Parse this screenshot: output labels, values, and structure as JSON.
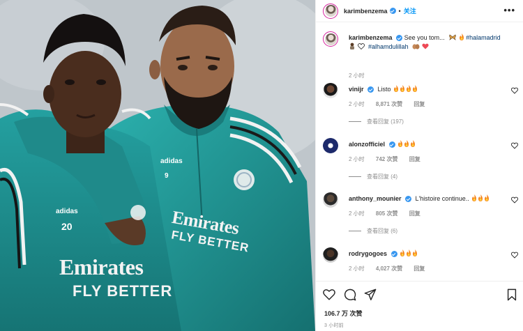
{
  "post": {
    "author": "karimbenzema",
    "follow_label": "关注",
    "more_label": "•••",
    "caption": {
      "text": "See you tom...",
      "hashtag_1": "#halamadrid",
      "hashtag_2": "#alhamdulillah",
      "time": "2 小时"
    },
    "likes_label": "106.7 万 次赞",
    "posted_time": "3 小时前",
    "jersey_left": {
      "number": "20",
      "brand": "adidas",
      "sponsor_line1": "Emirates",
      "sponsor_line2": "FLY BETTER"
    },
    "jersey_right": {
      "number": "9",
      "brand": "adidas",
      "sponsor_line1": "Emirates",
      "sponsor_line2": "FLY BETTER"
    }
  },
  "comments": [
    {
      "user": "vinijr",
      "verified": true,
      "text": "Listo",
      "time": "2 小时",
      "likes": "8,871 次赞",
      "reply_label": "回复",
      "view_replies": "查看回复 (197)"
    },
    {
      "user": "alonzofficiel",
      "verified": true,
      "text": "",
      "time": "2 小时",
      "likes": "742 次赞",
      "reply_label": "回复",
      "view_replies": "查看回复 (4)"
    },
    {
      "user": "anthony_mounier",
      "verified": true,
      "text": "L'histoire continue..",
      "time": "2 小时",
      "likes": "805 次赞",
      "reply_label": "回复",
      "view_replies": "查看回复 (6)"
    },
    {
      "user": "rodrygogoes",
      "verified": true,
      "text": "",
      "time": "2 小时",
      "likes": "4,027 次赞",
      "reply_label": "回复"
    }
  ],
  "colors": {
    "accent_blue": "#0095f6",
    "verified_blue": "#3897f0",
    "hashtag": "#00376b",
    "jersey_teal": "#1f8a8a",
    "muted": "#8e8e8e"
  },
  "icons": [
    "heart-icon",
    "comment-icon",
    "share-icon",
    "bookmark-icon",
    "more-icon",
    "fire-icon",
    "verified-icon"
  ]
}
